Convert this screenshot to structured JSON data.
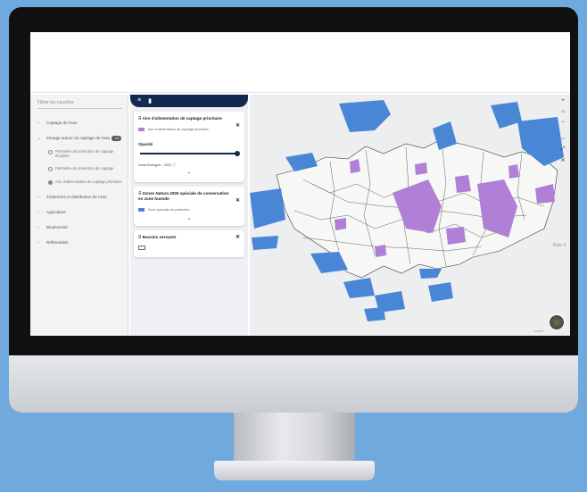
{
  "filter_panel": {
    "search_placeholder": "Filtrer les couches",
    "items": [
      {
        "label": "Captage de l'eau"
      },
      {
        "label": "Zonage autour du captage de l'eau",
        "badge": "1/3"
      },
      {
        "label": "Traitement et distribution de l'eau"
      },
      {
        "label": "Agriculture"
      },
      {
        "label": "Biodiversité"
      },
      {
        "label": "Référentiels"
      }
    ],
    "subitems": [
      "Périmètre de protection de captage éloignée",
      "Périmètre de protection de captage",
      "Aire d'alimentation de captage prioritaire"
    ]
  },
  "layer_panel": {
    "cards": [
      {
        "title": "Aire d'alimentation de captage prioritaire",
        "legend": "Aire d'alimentation de captage prioritaire",
        "legend_color": "#b07fd6",
        "opacity_label": "Opacité",
        "source": "Dreal Bretagne - 2022"
      },
      {
        "title": "Zones Natura 2000 spéciale de conservation en zone humide",
        "legend": "Zone spéciale de protection",
        "legend_color": "#4a86d6"
      },
      {
        "title": "Bassins versants"
      }
    ]
  },
  "map": {
    "controls": [
      "+",
      "⌂",
      "−",
      "↔",
      "⤢",
      "✕"
    ],
    "scale_text": "Leaflet",
    "label": "Baie d",
    "colors": {
      "sea": "#eceeef",
      "land": "#f7f7f5",
      "natura": "#4a86d6",
      "aac": "#b07fd6",
      "outline": "#3b3b3b"
    }
  }
}
